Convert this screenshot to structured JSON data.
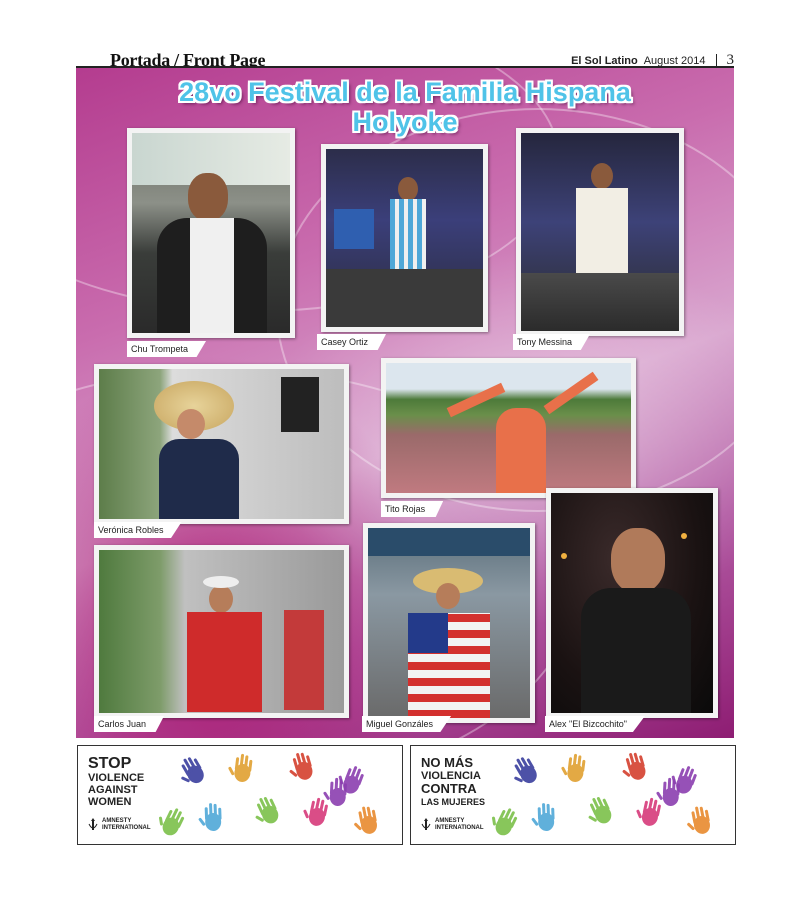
{
  "header": {
    "section": "Portada / Front Page",
    "publication": "El Sol Latino",
    "issue": "August 2014",
    "page_number": "3"
  },
  "feature": {
    "title_line1": "28vo Festival de la Familia Hispana",
    "title_line2": "Holyoke"
  },
  "photos": [
    {
      "caption": "Chu Trompeta"
    },
    {
      "caption": "Casey Ortiz"
    },
    {
      "caption": "Tony Messina"
    },
    {
      "caption": "Verónica Robles"
    },
    {
      "caption": "Tito Rojas"
    },
    {
      "caption": "Carlos Juan"
    },
    {
      "caption": "Miguel Gonzáles"
    },
    {
      "caption": "Alex \"El Bizcochito\""
    }
  ],
  "ads": [
    {
      "lines": [
        "STOP",
        "VIOLENCE",
        "AGAINST",
        "WOMEN"
      ],
      "org": [
        "AMNESTY",
        "INTERNATIONAL"
      ]
    },
    {
      "lines": [
        "NO MÁS",
        "VIOLENCIA",
        "CONTRA",
        "LAS MUJERES"
      ],
      "org": [
        "AMNESTY",
        "INTERNATIONAL"
      ]
    }
  ],
  "colors": {
    "title": "#4fc3e8",
    "panel": "#b43c8f",
    "hand_colors": [
      "#3a3f9e",
      "#e0a030",
      "#d4402e",
      "#8b3fb0",
      "#4fa8d8",
      "#7cc04a",
      "#d63a7a",
      "#e88a2e"
    ]
  }
}
